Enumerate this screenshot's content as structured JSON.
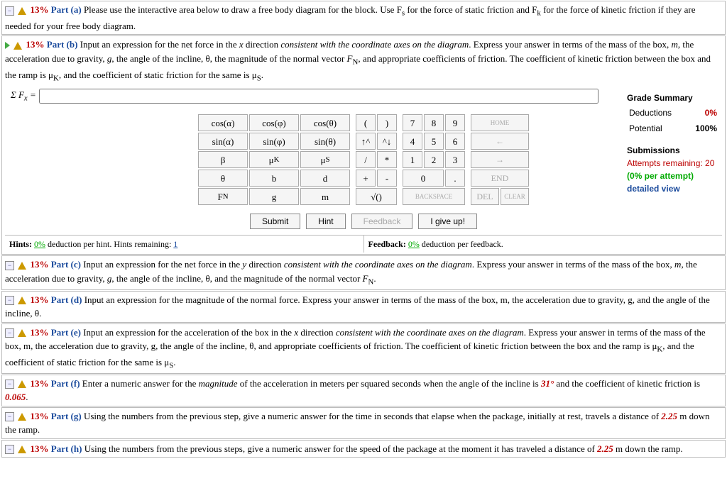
{
  "parts": {
    "a": {
      "percent": "13%",
      "label": "Part (a)",
      "text1": "Please use the interactive area below to draw a free body diagram for the block. Use F",
      "sub1": "s",
      "text2": " for the force of static friction and F",
      "sub2": "k",
      "text3": " for the force of kinetic friction if they are needed for your free body diagram."
    },
    "b": {
      "percent": "13%",
      "label": "Part (b)",
      "text1": "Input an expression for the net force in the ",
      "xvar": "x",
      "text2": " direction ",
      "consistent": "consistent with the coordinate axes on the diagram",
      "text3": ". Express your answer in terms of the mass of the box, ",
      "m": "m",
      "text4": ", the acceleration due to gravity, ",
      "g": "g",
      "text5": ", the angle of the incline, θ, the magnitude of the normal vector ",
      "fn": "F",
      "fnsub": "N",
      "text6": ", and appropriate coefficients of friction. The coefficient of kinetic friction between the box and the ramp is μ",
      "muk": "K",
      "text7": ", and the coefficient of static friction for the same is μ",
      "mus": "S",
      "text8": ".",
      "sigma": "Σ F",
      "sigmasub": "x",
      "eq": "="
    },
    "c": {
      "percent": "13%",
      "label": "Part (c)",
      "text1": "Input an expression for the net force in the ",
      "yvar": "y",
      "text2": " direction ",
      "consistent": "consistent with the coordinate axes on the diagram",
      "text3": ". Express your answer in terms of the mass of the box, ",
      "m": "m",
      "text4": ", the acceleration due to gravity, ",
      "g": "g",
      "text5": ", the angle of the incline, θ, and the magnitude of the normal vector ",
      "fn": "F",
      "fnsub": "N",
      "text6": "."
    },
    "d": {
      "percent": "13%",
      "label": "Part (d)",
      "text": "Input an expression for the magnitude of the normal force. Express your answer in terms of the mass of the box, m, the acceleration due to gravity, g, and the angle of the incline, θ."
    },
    "e": {
      "percent": "13%",
      "label": "Part (e)",
      "text1": "Input an expression for the acceleration of the box in the ",
      "xvar": "x",
      "text2": " direction ",
      "consistent": "consistent with the coordinate axes on the diagram",
      "text3": ". Express your answer in terms of the mass of the box, m, the acceleration due to gravity, g, the angle of the incline, θ, and appropriate coefficients of friction. The coefficient of kinetic friction between the box and the ramp is μ",
      "muk": "K",
      "text4": ", and the coefficient of static friction for the same is μ",
      "mus": "S",
      "text5": "."
    },
    "f": {
      "percent": "13%",
      "label": "Part (f)",
      "text1": "Enter a numeric answer for the ",
      "mag": "magnitude",
      "text2": " of the acceleration in meters per squared seconds when the angle of the incline is ",
      "angle": "31°",
      "text3": " and the coefficient of kinetic friction is ",
      "coef": "0.065",
      "text4": "."
    },
    "g": {
      "percent": "13%",
      "label": "Part (g)",
      "text1": "Using the numbers from the previous step, give a numeric answer for the time in seconds that elapse when the package, initially at rest, travels a distance of ",
      "dist": "2.25",
      "text2": " m down the ramp."
    },
    "h": {
      "percent": "13%",
      "label": "Part (h)",
      "text1": "Using the numbers from the previous steps, give a numeric answer for the speed of the package at the moment it has traveled a distance of ",
      "dist": "2.25",
      "text2": " m down the ramp."
    }
  },
  "grade": {
    "title": "Grade Summary",
    "ded_label": "Deductions",
    "ded_val": "0%",
    "pot_label": "Potential",
    "pot_val": "100%"
  },
  "submissions": {
    "title": "Submissions",
    "attempts_label": "Attempts remaining: ",
    "attempts_val": "20",
    "per_attempt_pre": "(",
    "per_attempt_val": "0%",
    "per_attempt_post": " per attempt)",
    "detailed": "detailed view"
  },
  "keypad": {
    "vars": [
      [
        "cos(α)",
        "cos(φ)",
        "cos(θ)"
      ],
      [
        "sin(α)",
        "sin(φ)",
        "sin(θ)"
      ],
      [
        "β",
        "μK",
        "μS"
      ],
      [
        "θ",
        "b",
        "d"
      ],
      [
        "FN",
        "g",
        "m"
      ]
    ],
    "ops": [
      [
        "(",
        ")"
      ],
      [
        "↑^",
        "^↓"
      ],
      [
        "/",
        "*"
      ],
      [
        "+",
        "-"
      ],
      [
        "√()"
      ]
    ],
    "nums": [
      [
        "7",
        "8",
        "9"
      ],
      [
        "4",
        "5",
        "6"
      ],
      [
        "1",
        "2",
        "3"
      ],
      [
        "0",
        "."
      ],
      [
        "BACKSPACE"
      ]
    ],
    "right": [
      [
        "HOME"
      ],
      [
        "←"
      ],
      [
        "→"
      ],
      [
        "END"
      ],
      [
        "DEL",
        "CLEAR"
      ]
    ]
  },
  "actions": {
    "submit": "Submit",
    "hint": "Hint",
    "feedback": "Feedback",
    "giveup": "I give up!"
  },
  "hintrow": {
    "hints_label": "Hints:",
    "hints_pct": "0%",
    "hints_text": " deduction per hint. Hints remaining: ",
    "hints_rem": "1",
    "fb_label": "Feedback:",
    "fb_pct": "0%",
    "fb_text": " deduction per feedback."
  }
}
